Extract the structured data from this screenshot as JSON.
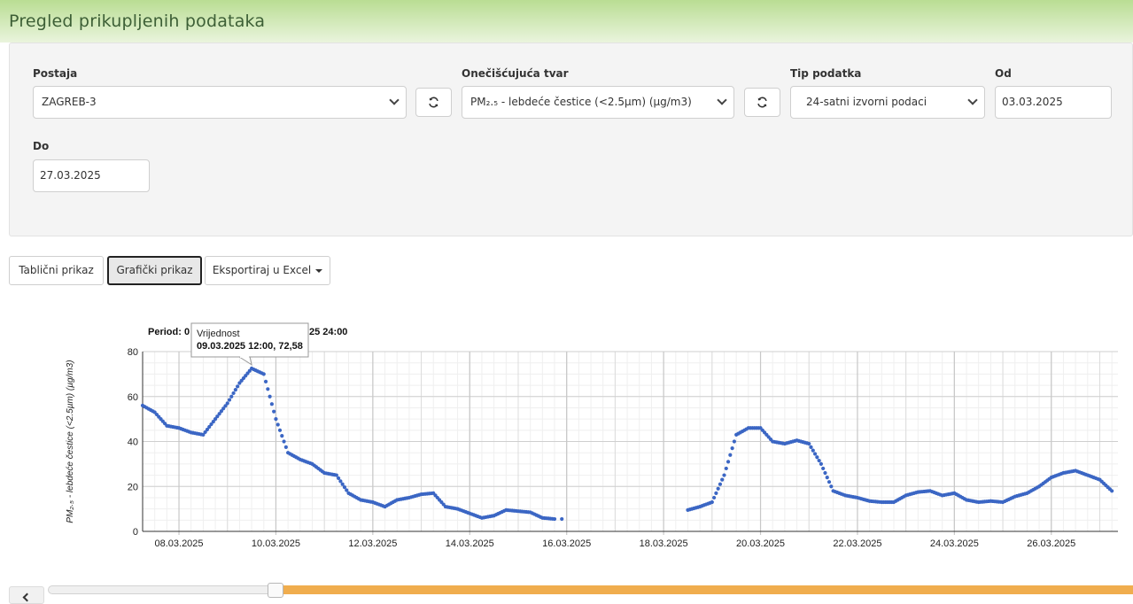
{
  "page": {
    "title": "Pregled prikupljenih podataka"
  },
  "filters": {
    "station": {
      "label": "Postaja",
      "value": "ZAGREB-3"
    },
    "pollutant": {
      "label": "Onečišćujuća tvar",
      "value": "PM₂.₅ - lebdeće čestice (<2.5µm) (µg/m3)"
    },
    "data_type": {
      "label": "Tip podatka",
      "value": "24-satni izvorni podaci"
    },
    "from": {
      "label": "Od",
      "value": "03.03.2025"
    },
    "to": {
      "label": "Do",
      "value": "27.03.2025"
    }
  },
  "view_buttons": {
    "table": "Tablični prikaz",
    "chart": "Grafički prikaz",
    "export": "Eksportiraj u Excel"
  },
  "tooltip": {
    "title": "Vrijednost",
    "value": "09.03.2025 12:00, 72,58"
  },
  "chart_data": {
    "type": "scatter",
    "title": "Period: 0… 25 24:00",
    "ylabel": "PM₂.₅ - lebdeće čestice (<2.5µm) (µg/m3)",
    "xlabel": "",
    "ylim": [
      0,
      80
    ],
    "xlim": [
      "07.03.2025 06:00",
      "27.03.2025 09:00"
    ],
    "yticks": [
      0,
      20,
      40,
      60,
      80
    ],
    "xticks": [
      "08.03.2025",
      "10.03.2025",
      "12.03.2025",
      "14.03.2025",
      "16.03.2025",
      "18.03.2025",
      "20.03.2025",
      "22.03.2025",
      "24.03.2025",
      "26.03.2025"
    ],
    "grid": true,
    "legend": "none",
    "marker_color": "#3b66c4",
    "series": [
      {
        "x_day": [
          7.25,
          7.5,
          7.75,
          8.0,
          8.25,
          8.5,
          8.75,
          9.0,
          9.25,
          9.5,
          9.75,
          10.0,
          10.25,
          10.5,
          10.75,
          11.0,
          11.25,
          11.5,
          11.75,
          12.0,
          12.25,
          12.5,
          12.75,
          13.0,
          13.25,
          13.5,
          13.75,
          14.0,
          14.25,
          14.5,
          14.75,
          15.0,
          15.25,
          15.5,
          15.75
        ],
        "y": [
          56,
          53,
          47,
          46,
          44,
          43,
          50,
          57,
          66,
          72.5,
          70,
          50,
          35,
          32,
          30,
          26,
          25,
          17,
          14,
          13,
          11,
          14,
          15,
          16.5,
          17,
          11,
          10,
          8,
          6,
          7,
          9.5,
          9,
          8.5,
          6,
          5.5
        ]
      },
      {
        "x_day": [
          15.9
        ],
        "y": [
          5.5
        ]
      },
      {
        "x_day": [
          18.5,
          18.75,
          19.0,
          19.25,
          19.5,
          19.75,
          20.0,
          20.25,
          20.5,
          20.75,
          21.0,
          21.25,
          21.5,
          21.75,
          22.0,
          22.25,
          22.5,
          22.75,
          23.0,
          23.25,
          23.5,
          23.75,
          24.0,
          24.25,
          24.5,
          24.75,
          25.0,
          25.25,
          25.5,
          25.75,
          26.0,
          26.25,
          26.5,
          26.75,
          27.0,
          27.25
        ],
        "y": [
          9.5,
          11,
          13,
          25,
          43,
          46,
          46,
          40,
          39,
          40.5,
          39,
          30,
          18,
          16,
          15,
          13.5,
          13,
          13,
          16,
          17.5,
          18,
          16,
          17,
          14,
          13,
          13.5,
          13,
          15.5,
          17,
          20,
          24,
          26,
          27,
          25,
          23,
          18
        ]
      }
    ]
  }
}
